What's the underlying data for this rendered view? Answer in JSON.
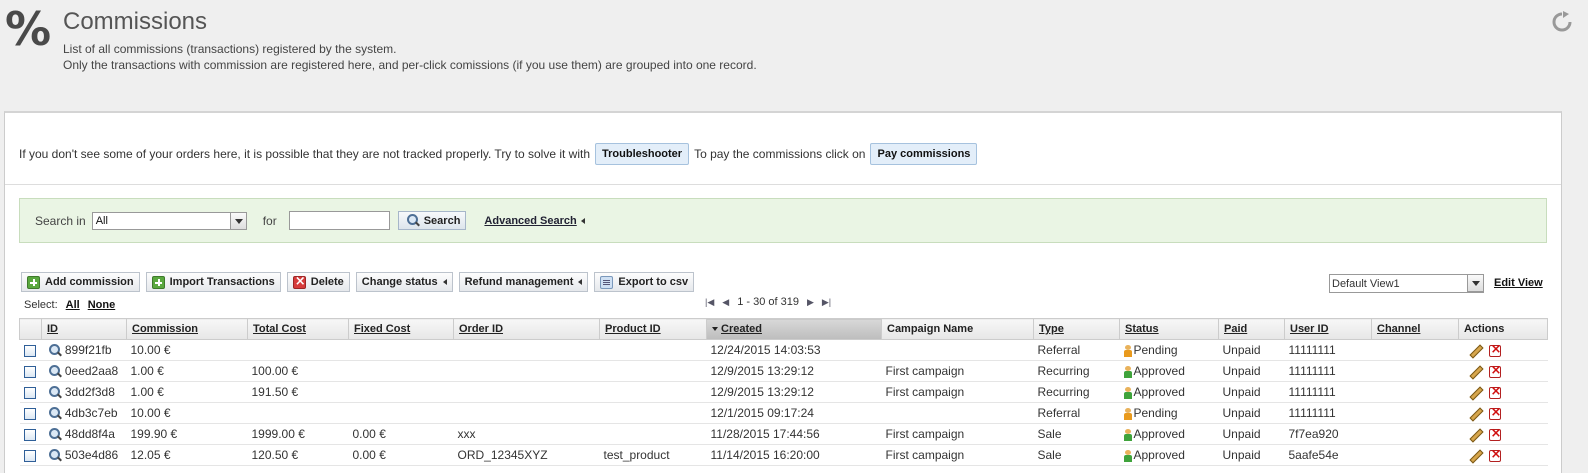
{
  "header": {
    "icon": "percent-icon",
    "icon_glyph": "%",
    "title": "Commissions",
    "desc_line1": "List of all commissions (transactions) registered by the system.",
    "desc_line2": "Only the transactions with commission are registered here, and per-click comissions (if you use them) are grouped into one record."
  },
  "info": {
    "text1": "If you don't see some of your orders here, it is possible that they are not tracked properly. Try to solve it with",
    "troubleshooter": "Troubleshooter",
    "text2": "To pay the commissions click on",
    "pay": "Pay commissions"
  },
  "search": {
    "label": "Search in",
    "scope": "All",
    "for_label": "for",
    "value": "",
    "button": "Search",
    "advanced": "Advanced Search"
  },
  "toolbar": {
    "add": "Add commission",
    "import": "Import Transactions",
    "delete": "Delete",
    "change_status": "Change status",
    "refund": "Refund management",
    "export": "Export to csv"
  },
  "select": {
    "label": "Select:",
    "all": "All",
    "none": "None"
  },
  "pager": {
    "range": "1 - 30 of 319"
  },
  "view": {
    "selected": "Default View1",
    "edit": "Edit View"
  },
  "columns": [
    "ID",
    "Commission",
    "Total Cost",
    "Fixed Cost",
    "Order ID",
    "Product ID",
    "Created",
    "Campaign Name",
    "Type",
    "Status",
    "Paid",
    "User ID",
    "Channel",
    "Actions"
  ],
  "rows": [
    {
      "id": "899f21fb",
      "commission": "10.00 €",
      "total": "",
      "fixed": "",
      "order": "",
      "product": "",
      "created": "12/24/2015 14:03:53",
      "campaign": "",
      "type": "Referral",
      "status": "Pending",
      "paid": "Unpaid",
      "user": "11111111",
      "channel": ""
    },
    {
      "id": "0eed2aa8",
      "commission": "1.00 €",
      "total": "100.00 €",
      "fixed": "",
      "order": "",
      "product": "",
      "created": "12/9/2015 13:29:12",
      "campaign": "First campaign",
      "type": "Recurring",
      "status": "Approved",
      "paid": "Unpaid",
      "user": "11111111",
      "channel": ""
    },
    {
      "id": "3dd2f3d8",
      "commission": "1.00 €",
      "total": "191.50 €",
      "fixed": "",
      "order": "",
      "product": "",
      "created": "12/9/2015 13:29:12",
      "campaign": "First campaign",
      "type": "Recurring",
      "status": "Approved",
      "paid": "Unpaid",
      "user": "11111111",
      "channel": ""
    },
    {
      "id": "4db3c7eb",
      "commission": "10.00 €",
      "total": "",
      "fixed": "",
      "order": "",
      "product": "",
      "created": "12/1/2015 09:17:24",
      "campaign": "",
      "type": "Referral",
      "status": "Pending",
      "paid": "Unpaid",
      "user": "11111111",
      "channel": ""
    },
    {
      "id": "48dd8f4a",
      "commission": "199.90 €",
      "total": "1999.00 €",
      "fixed": "0.00 €",
      "order": "xxx",
      "product": "",
      "created": "11/28/2015 17:44:56",
      "campaign": "First campaign",
      "type": "Sale",
      "status": "Approved",
      "paid": "Unpaid",
      "user": "7f7ea920",
      "channel": ""
    },
    {
      "id": "503e4d86",
      "commission": "12.05 €",
      "total": "120.50 €",
      "fixed": "0.00 €",
      "order": "ORD_12345XYZ",
      "product": "test_product",
      "created": "11/14/2015 16:20:00",
      "campaign": "First campaign",
      "type": "Sale",
      "status": "Approved",
      "paid": "Unpaid",
      "user": "5aafe54e",
      "channel": ""
    }
  ],
  "colors": {
    "panel_bg": "#ffffff",
    "search_bg": "#eaf5e4",
    "page_bg": "#efefef",
    "button_blue": "#e3eef9"
  }
}
